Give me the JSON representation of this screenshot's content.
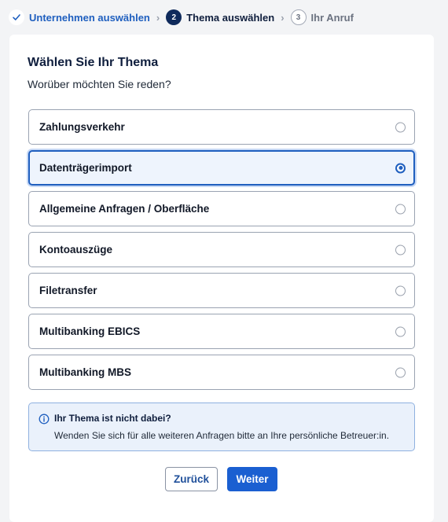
{
  "stepper": {
    "steps": [
      {
        "number": "",
        "label": "Unternehmen auswählen",
        "state": "done"
      },
      {
        "number": "2",
        "label": "Thema auswählen",
        "state": "current"
      },
      {
        "number": "3",
        "label": "Ihr Anruf",
        "state": "todo"
      }
    ],
    "separator": "›"
  },
  "form": {
    "title": "Wählen Sie Ihr Thema",
    "subtitle": "Worüber möchten Sie reden?",
    "options": [
      {
        "label": "Zahlungsverkehr",
        "selected": false
      },
      {
        "label": "Datenträgerimport",
        "selected": true
      },
      {
        "label": "Allgemeine Anfragen / Oberfläche",
        "selected": false
      },
      {
        "label": "Kontoauszüge",
        "selected": false
      },
      {
        "label": "Filetransfer",
        "selected": false
      },
      {
        "label": "Multibanking EBICS",
        "selected": false
      },
      {
        "label": "Multibanking MBS",
        "selected": false
      }
    ]
  },
  "info": {
    "title": "Ihr Thema ist nicht dabei?",
    "text": "Wenden Sie sich für alle weiteren Anfragen bitte an Ihre persönliche Betreuer:in."
  },
  "buttons": {
    "back": "Zurück",
    "next": "Weiter"
  },
  "colors": {
    "accent": "#1a5fd1",
    "navy": "#0f2a5c"
  }
}
